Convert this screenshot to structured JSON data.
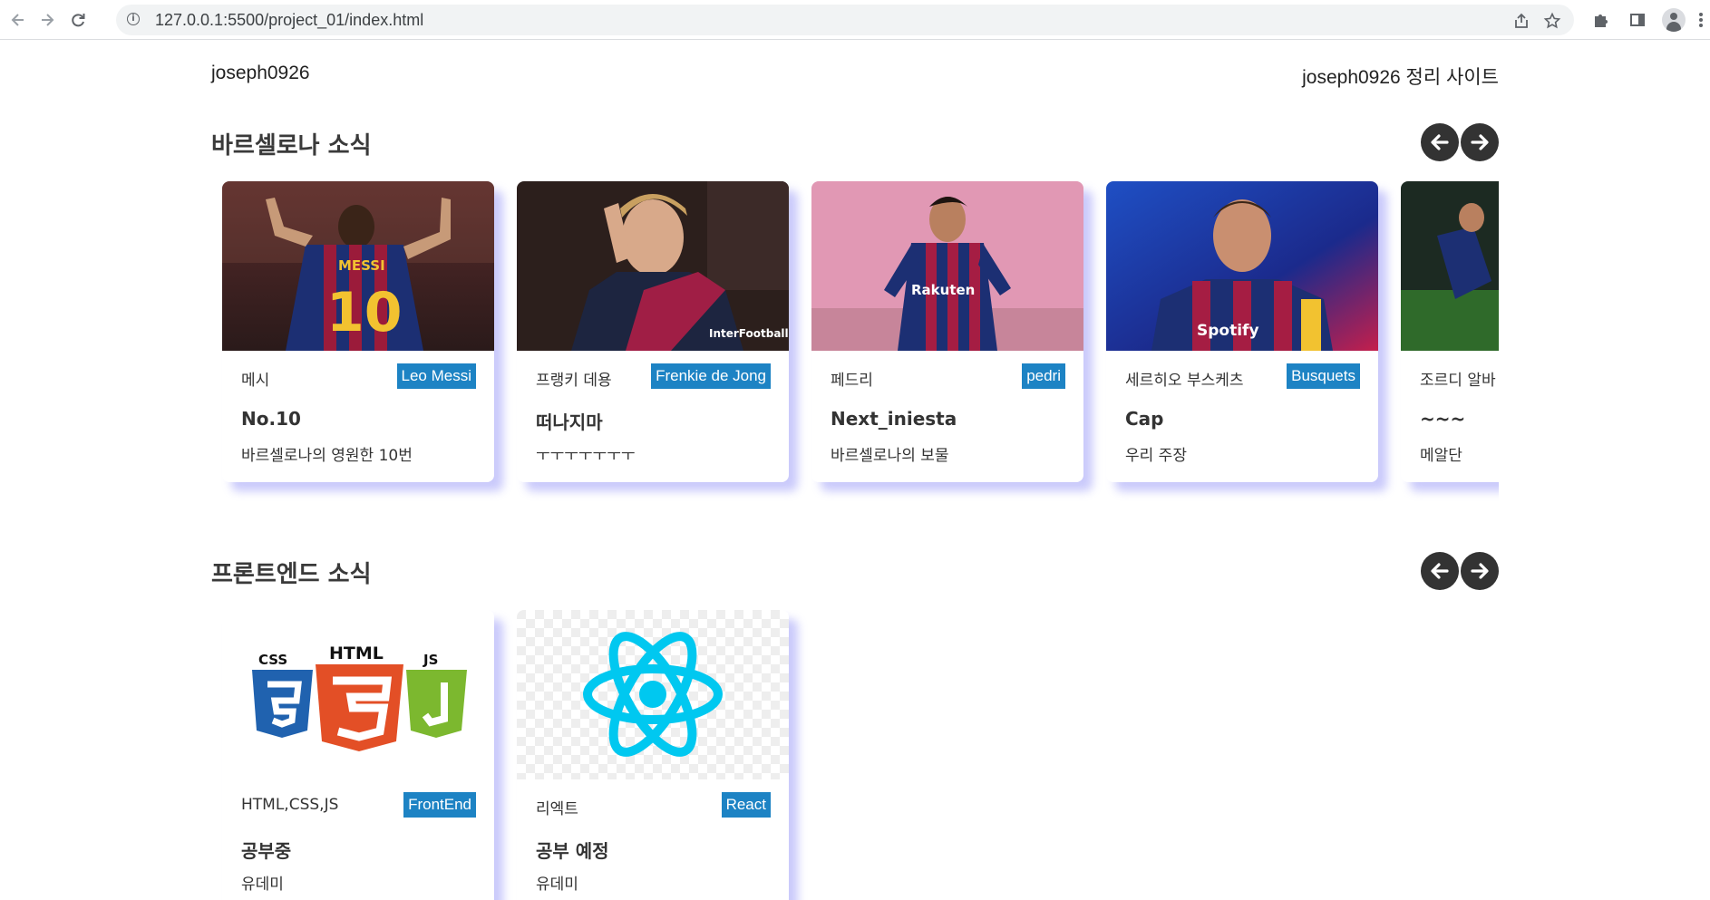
{
  "browser": {
    "url": "127.0.0.1:5500/project_01/index.html",
    "back_icon": "arrow-left-icon",
    "forward_icon": "arrow-right-icon",
    "reload_icon": "reload-icon"
  },
  "header": {
    "logo": "joseph0926",
    "site_title": "joseph0926 정리 사이트"
  },
  "sections": [
    {
      "title": "바르셀로나 소식",
      "cards": [
        {
          "name": "메시",
          "tag": "Leo Messi",
          "heading": "No.10",
          "desc": "바르셀로나의 영원한 10번",
          "jersey_number": "10",
          "jersey_name": "MESSI"
        },
        {
          "name": "프랭키 데용",
          "tag": "Frenkie de Jong",
          "heading": "떠나지마",
          "desc": "ㅜㅜㅜㅜㅜㅜㅜ",
          "watermark": "InterFootball"
        },
        {
          "name": "페드리",
          "tag": "pedri",
          "heading": "Next_iniesta",
          "desc": "바르셀로나의 보물",
          "sponsor": "Rakuten"
        },
        {
          "name": "세르히오 부스케츠",
          "tag": "Busquets",
          "heading": "Cap",
          "desc": "우리 주장",
          "sponsor": "Spotify"
        },
        {
          "name": "조르디 알바",
          "tag": "",
          "heading": "~~~",
          "desc": "메알단"
        }
      ]
    },
    {
      "title": "프론트엔드 소식",
      "cards": [
        {
          "name": "HTML,CSS,JS",
          "tag": "FrontEnd",
          "heading": "공부중",
          "desc": "유데미",
          "logo_labels": [
            "CSS",
            "HTML",
            "JS"
          ]
        },
        {
          "name": "리엑트",
          "tag": "React",
          "heading": "공부 예정",
          "desc": "유데미"
        }
      ]
    }
  ],
  "colors": {
    "tag_bg": "#1d83c4",
    "arrow_bg": "#333333",
    "card_shadow": "#b8b8fa"
  }
}
